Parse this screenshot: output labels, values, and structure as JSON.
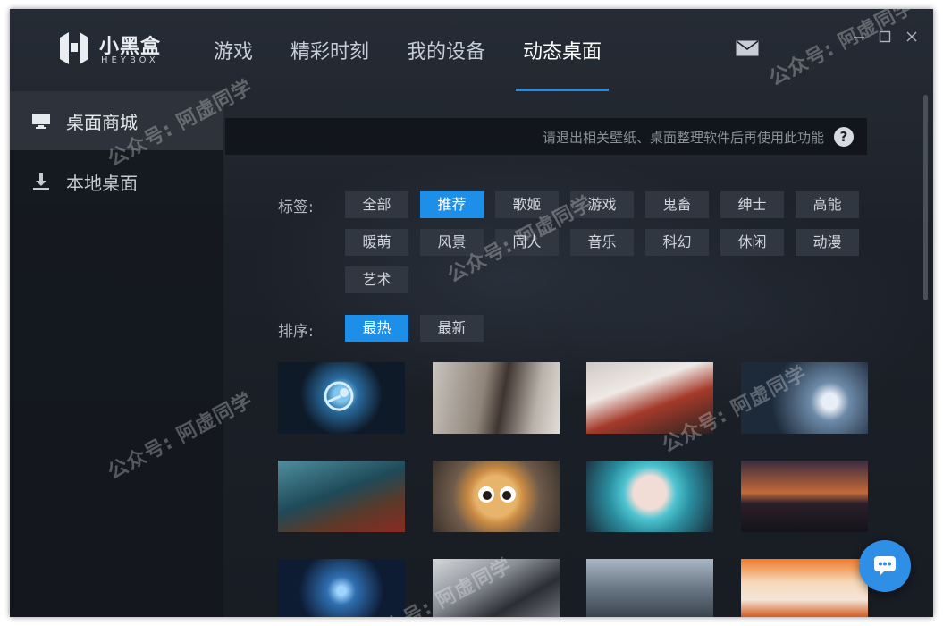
{
  "app": {
    "logo_cn": "小黑盒",
    "logo_en": "HEYBOX"
  },
  "nav": {
    "items": [
      {
        "label": "游戏"
      },
      {
        "label": "精彩时刻"
      },
      {
        "label": "我的设备"
      },
      {
        "label": "动态桌面"
      }
    ],
    "active_index": 3
  },
  "sidebar": {
    "items": [
      {
        "label": "桌面商城",
        "icon": "monitor-icon"
      },
      {
        "label": "本地桌面",
        "icon": "download-icon"
      }
    ]
  },
  "notice": {
    "text": "请退出相关壁纸、桌面整理软件后再使用此功能",
    "help_glyph": "?"
  },
  "filters": {
    "tag_label": "标签:",
    "tags": [
      "全部",
      "推荐",
      "歌姬",
      "游戏",
      "鬼畜",
      "绅士",
      "高能",
      "暖萌",
      "风景",
      "同人",
      "音乐",
      "科幻",
      "休闲",
      "动漫",
      "艺术"
    ],
    "active_tag": "推荐",
    "sort_label": "排序:",
    "sorts": [
      "最热",
      "最新"
    ],
    "active_sort": "最热"
  },
  "watermark": {
    "text": "公众号: 阿虚同学"
  },
  "colors": {
    "accent": "#1e8fe8",
    "window_bg": "#1b1f27",
    "tag_bg": "#313741",
    "chat_button": "#2f8fe6"
  }
}
